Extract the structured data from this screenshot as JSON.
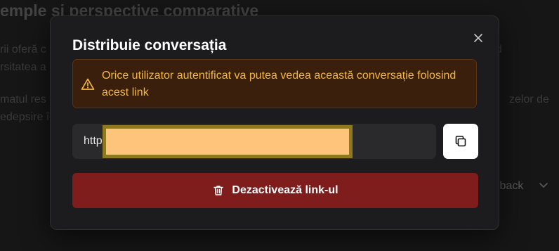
{
  "background": {
    "heading": "emple și perspective comparative",
    "lines_left": [
      "rii oferă c",
      "rsitatea a",
      "matul res",
      "edepsire î"
    ],
    "lines_right": [
      "d",
      "zelor de"
    ],
    "feedback_label": "lback"
  },
  "dialog": {
    "title": "Distribuie conversația",
    "close_icon": "close-icon",
    "warning": {
      "icon": "warning-triangle-icon",
      "text": "Orice utilizator autentificat va putea vedea această conversație folosind acest link",
      "color": "#f4b740"
    },
    "link": {
      "visible_prefix": "http"
    },
    "copy_button": {
      "icon": "copy-icon"
    },
    "deactivate_button": {
      "icon": "trash-icon",
      "label": "Dezactivează link-ul",
      "color": "#7f1d1d"
    }
  }
}
